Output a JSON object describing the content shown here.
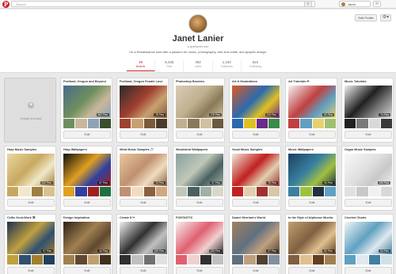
{
  "topbar": {
    "logo": "P",
    "search_placeholder": "Search",
    "menu_icon": "≡",
    "user_name": "Janet",
    "messages_icon": "✉"
  },
  "profile": {
    "edit_label": "Edit Profile",
    "settings_icon": "⚙▾",
    "name": "Janet Lanier",
    "website": "● janetlanier.com",
    "bio": "I'm a Renaissance soul with a passion for music, photography, arts and crafts, and graphic design.",
    "stats": [
      {
        "num": "49",
        "label": "Boards"
      },
      {
        "num": "8,435",
        "label": "Pins"
      },
      {
        "num": "492",
        "label": "Likes"
      },
      {
        "num": "1,192",
        "label": "Followers"
      },
      {
        "num": "622",
        "label": "Following"
      }
    ]
  },
  "create_board_label": "Create a board",
  "boards": [
    {
      "title": "Portland, Oregon and Beyond",
      "count": "562 Pins",
      "edit": "Edit",
      "colors": [
        "#4a6a8a",
        "#6f8f5f",
        "#c9b79c",
        "#8fa3b8",
        "#3a4d2d"
      ]
    },
    {
      "title": "Portland, Oregon Foodie Love",
      "count": "75 Pins",
      "edit": "Edit",
      "colors": [
        "#2a2a2a",
        "#a04030",
        "#c8a070",
        "#7a5a3a",
        "#4a3a2a"
      ]
    },
    {
      "title": "Photoshop Brushes",
      "count": "278 Pins",
      "edit": "Edit",
      "colors": [
        "#d8cdb8",
        "#c0b090",
        "#8a7a5a",
        "#d0c0a0",
        "#6a5a40"
      ]
    },
    {
      "title": "Art & Illustrations",
      "count": "215 Pins",
      "edit": "Edit",
      "colors": [
        "#e05a20",
        "#2a6ab0",
        "#e0c020",
        "#6a2a8a",
        "#3a8a4a"
      ]
    },
    {
      "title": "Art Tutorials ✏",
      "count": "60 Pins",
      "edit": "Edit",
      "colors": [
        "#f4f4f4",
        "#c04040",
        "#60a0c0",
        "#e8d070",
        "#a0c070"
      ]
    },
    {
      "title": "Music Tutorials",
      "count": "74 Pins",
      "edit": "Edit",
      "colors": [
        "#f0f0f0",
        "#202020",
        "#7a7a7a",
        "#d8d8d8",
        "#3a3a3a"
      ]
    },
    {
      "title": "Harp Music Samples",
      "count": "122 Pins",
      "edit": "Edit",
      "colors": [
        "#e8d8a0",
        "#c8a860",
        "#f0e8c8",
        "#a08040",
        "#d8c090"
      ]
    },
    {
      "title": "Harp Wallpapers",
      "count": "87 Pins",
      "edit": "Edit",
      "colors": [
        "#101010",
        "#e0a020",
        "#3040a0",
        "#a02020",
        "#207040"
      ]
    },
    {
      "title": "Wind Music Samples 🎵",
      "count": "73 Pins",
      "edit": "Edit",
      "colors": [
        "#e8c8a0",
        "#c09070",
        "#f0dcc0",
        "#8a6040",
        "#d0a880"
      ]
    },
    {
      "title": "Woodwind Wallpapers",
      "count": "57 Pins",
      "edit": "Edit",
      "colors": [
        "#8aa0a0",
        "#c0c8b8",
        "#4a6060",
        "#a0b0a8",
        "#d8d8c8"
      ]
    },
    {
      "title": "Vocal Music Samples",
      "count": "75 Pins",
      "edit": "Edit",
      "colors": [
        "#f0e8d8",
        "#c02020",
        "#e0d0b0",
        "#a03030",
        "#d8c8a8"
      ]
    },
    {
      "title": "Music Wallpapers",
      "count": "94 Pins",
      "edit": "Edit",
      "colors": [
        "#1a4060",
        "#3a80a0",
        "#a0c040",
        "#203040",
        "#60a0c0"
      ]
    },
    {
      "title": "Organ Music Samples",
      "count": "106 Pins",
      "edit": "Edit",
      "colors": [
        "#f8f8f8",
        "#e0e0e0",
        "#c8c8c8",
        "#f0f0f0",
        "#d8d8d8"
      ]
    },
    {
      "title": "Celtic Knot-Work ⌘",
      "count": "97 Pins",
      "edit": "Edit",
      "colors": [
        "#1a3050",
        "#c0a040",
        "#305070",
        "#a08030",
        "#204060"
      ]
    },
    {
      "title": "Design Inspiration",
      "count": "42 Pins",
      "edit": "Edit",
      "colors": [
        "#2a2018",
        "#a08050",
        "#604830",
        "#c0a070",
        "#403020"
      ]
    },
    {
      "title": "Create It ✂",
      "count": "155 Pins",
      "edit": "Edit",
      "colors": [
        "#f0f0f0",
        "#303030",
        "#c0c0c0",
        "#707070",
        "#e0e0e0"
      ]
    },
    {
      "title": "FONTASTIC",
      "count": "126 Pins",
      "edit": "Edit",
      "colors": [
        "#f8f0f0",
        "#e06070",
        "#f0d0d0",
        "#303030",
        "#c0c0c0"
      ]
    },
    {
      "title": "Daniel Merriam's World",
      "count": "27 Pins",
      "edit": "Edit",
      "colors": [
        "#a08060",
        "#607080",
        "#c0a080",
        "#504030",
        "#8090a0"
      ]
    },
    {
      "title": "In the Style of Alphonse Mucha",
      "count": "82 Pins",
      "edit": "Edit",
      "colors": [
        "#c0a070",
        "#806040",
        "#e0c090",
        "#604020",
        "#a08050"
      ]
    },
    {
      "title": "Crochet Charts",
      "count": "24 Pins",
      "edit": "Edit",
      "colors": [
        "#f0f8f8",
        "#60a0c0",
        "#e0e8f0",
        "#4080a0",
        "#d0e0e8"
      ]
    }
  ]
}
